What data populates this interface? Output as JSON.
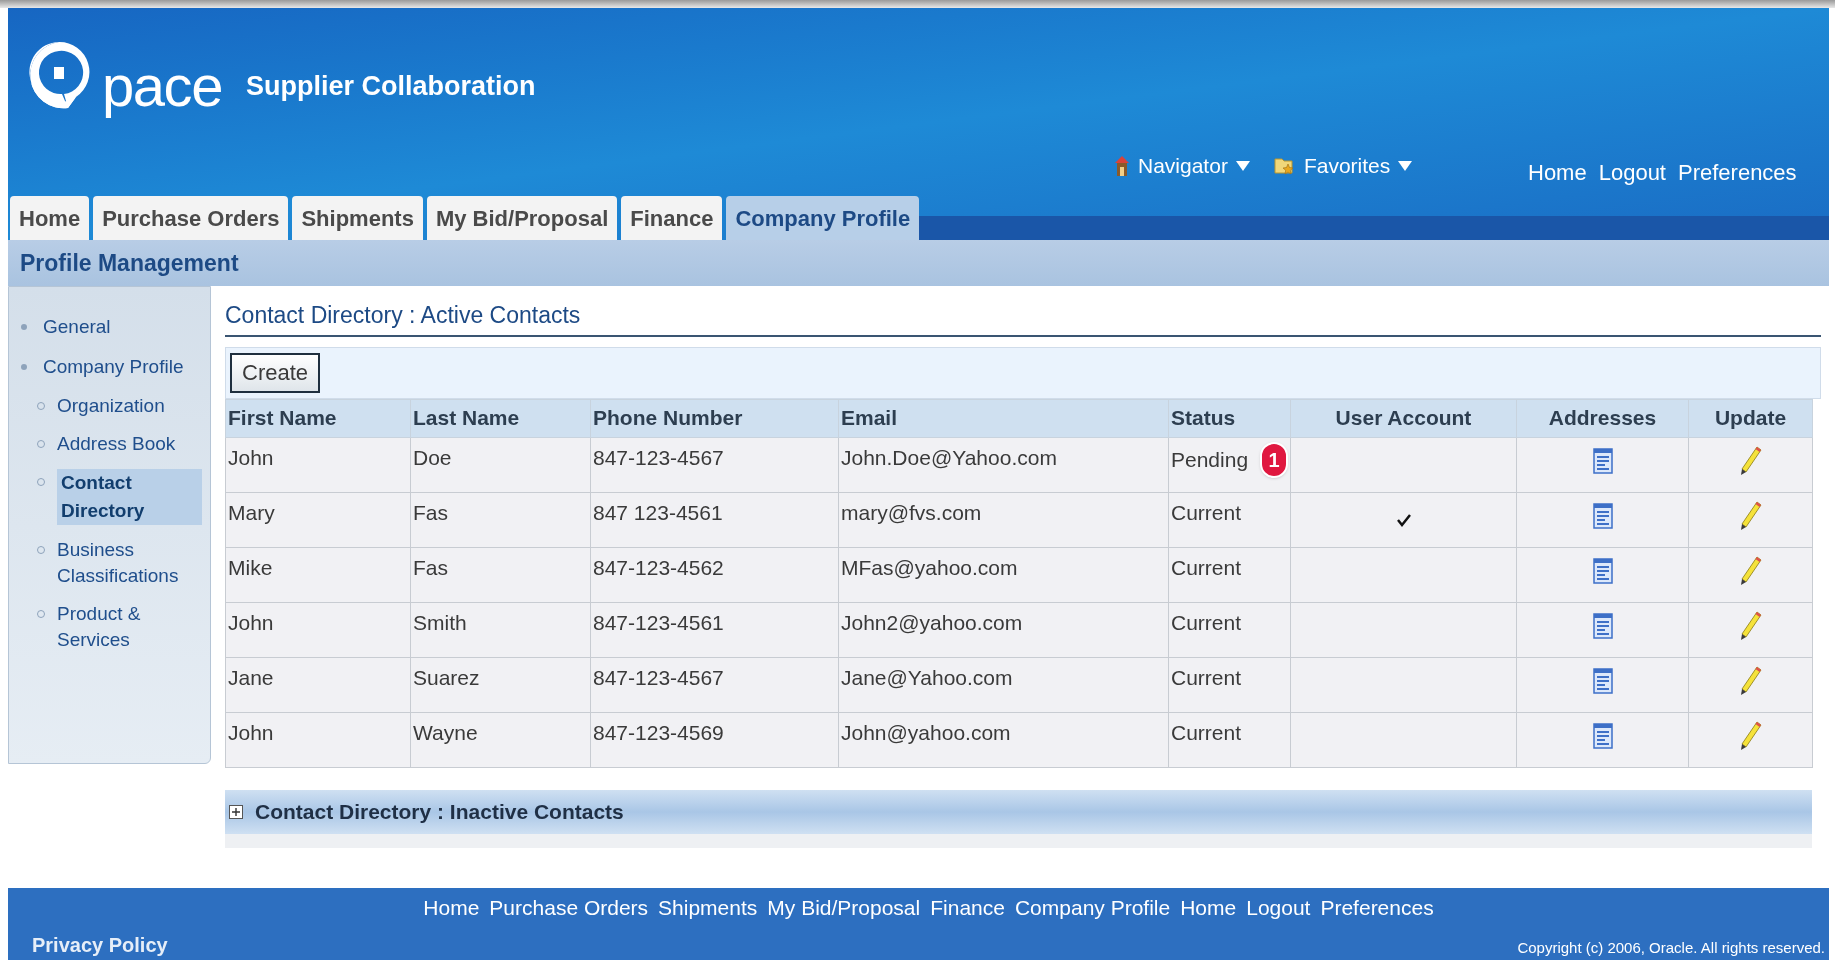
{
  "header": {
    "logo_text": "pace",
    "app_title": "Supplier Collaboration",
    "global_menus": [
      {
        "label": "Navigator",
        "kind": "navigator"
      },
      {
        "label": "Favorites",
        "kind": "favorites"
      }
    ],
    "global_links": [
      "Home",
      "Logout",
      "Preferences"
    ]
  },
  "tabs": [
    {
      "label": "Home",
      "selected": false
    },
    {
      "label": "Purchase Orders",
      "selected": false
    },
    {
      "label": "Shipments",
      "selected": false
    },
    {
      "label": "My Bid/Proposal",
      "selected": false
    },
    {
      "label": "Finance",
      "selected": false
    },
    {
      "label": "Company Profile",
      "selected": true
    }
  ],
  "subtab": "Profile Management",
  "sidebar": {
    "items": [
      {
        "label": "General",
        "selected": false
      },
      {
        "label": "Company Profile",
        "selected": false,
        "children": [
          {
            "label": "Organization",
            "selected": false
          },
          {
            "label": "Address Book",
            "selected": false
          },
          {
            "label": "Contact Directory",
            "selected": true
          },
          {
            "label": "Business Classifications",
            "selected": false
          },
          {
            "label": "Product & Services",
            "selected": false
          }
        ]
      }
    ]
  },
  "section_title": "Contact Directory : Active Contacts",
  "create_button": "Create",
  "table": {
    "columns": [
      "First Name",
      "Last Name",
      "Phone Number",
      "Email",
      "Status",
      "User Account",
      "Addresses",
      "Update"
    ],
    "rows": [
      {
        "first_name": "John",
        "last_name": "Doe",
        "phone": "847-123-4567",
        "email": "John.Doe@Yahoo.com",
        "status": "Pending",
        "callout": "1",
        "user_account": false
      },
      {
        "first_name": "Mary",
        "last_name": "Fas",
        "phone": "847 123-4561",
        "email": "mary@fvs.com",
        "status": "Current",
        "user_account": true
      },
      {
        "first_name": "Mike",
        "last_name": "Fas",
        "phone": "847-123-4562",
        "email": "MFas@yahoo.com",
        "status": "Current",
        "user_account": false
      },
      {
        "first_name": "John",
        "last_name": "Smith",
        "phone": "847-123-4561",
        "email": "John2@yahoo.com",
        "status": "Current",
        "user_account": false
      },
      {
        "first_name": "Jane",
        "last_name": "Suarez",
        "phone": "847-123-4567",
        "email": "Jane@Yahoo.com",
        "status": "Current",
        "user_account": false
      },
      {
        "first_name": "John",
        "last_name": "Wayne",
        "phone": "847-123-4569",
        "email": "John@yahoo.com",
        "status": "Current",
        "user_account": false
      }
    ]
  },
  "inactive_section": {
    "title": "Contact Directory : Inactive Contacts",
    "expanded": false
  },
  "footer": {
    "links": [
      "Home",
      "Purchase Orders",
      "Shipments",
      "My Bid/Proposal",
      "Finance",
      "Company Profile",
      "Home",
      "Logout",
      "Preferences"
    ],
    "privacy_policy": "Privacy Policy",
    "copyright": "Copyright (c) 2006, Oracle. All rights reserved."
  }
}
